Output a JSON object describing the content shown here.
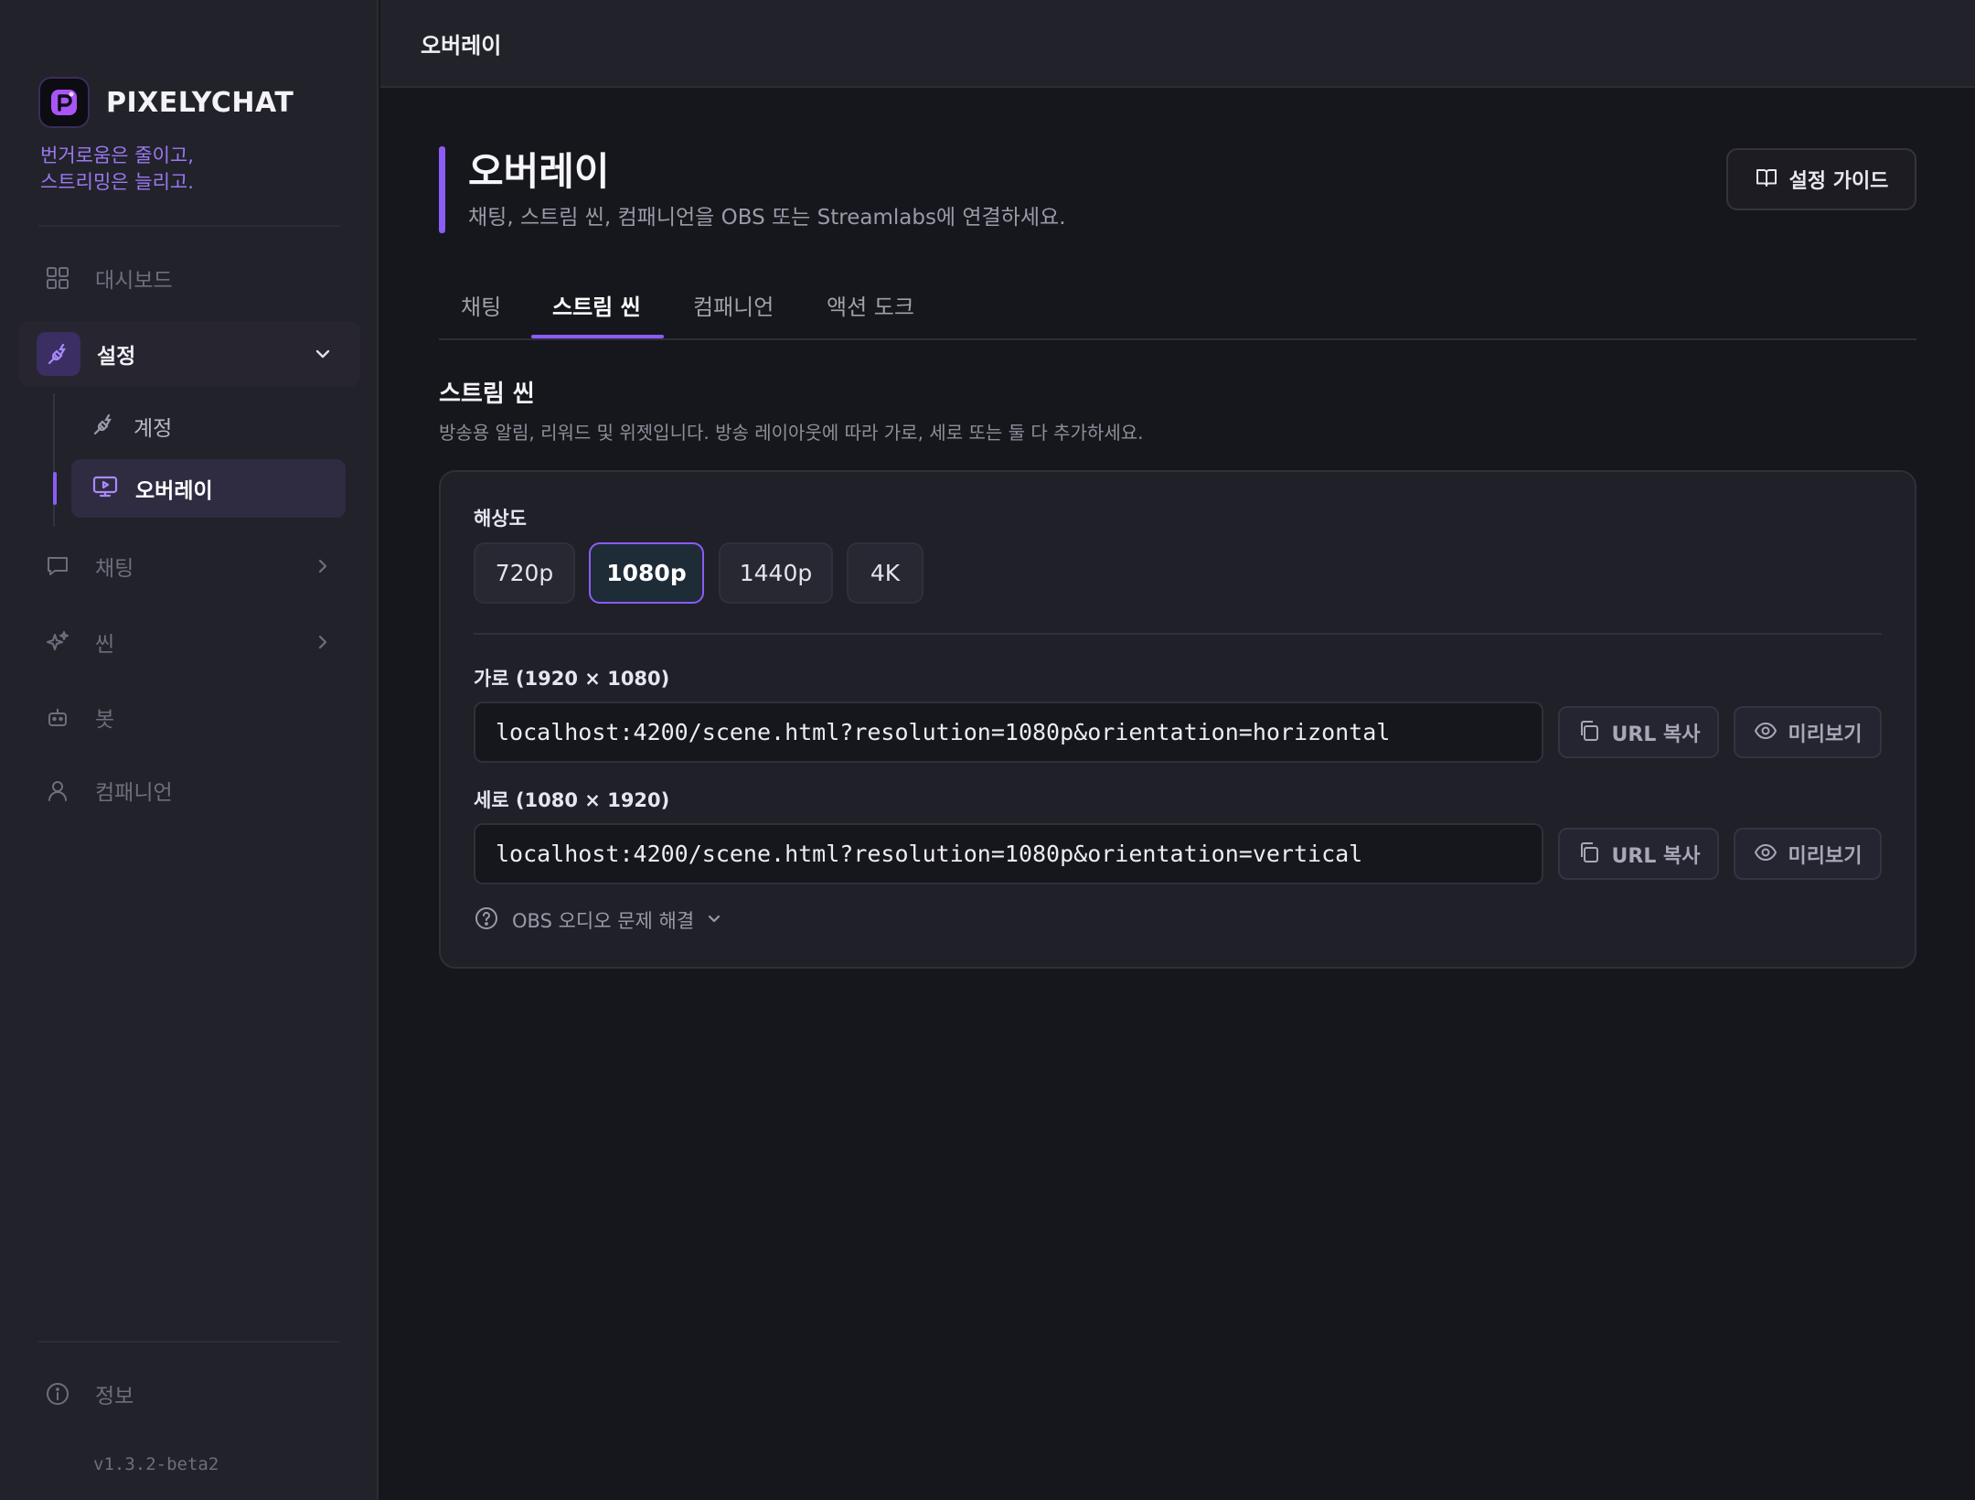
{
  "brand": {
    "name": "PIXELYCHAT",
    "tagline_line1": "번거로움은 줄이고,",
    "tagline_line2": "스트리밍은 늘리고."
  },
  "sidebar": {
    "dashboard": "대시보드",
    "settings": "설정",
    "settings_sub": {
      "account": "계정",
      "overlay": "오버레이"
    },
    "chat": "채팅",
    "scene": "씬",
    "bot": "봇",
    "companion": "컴패니언",
    "info": "정보",
    "version": "v1.3.2-beta2"
  },
  "header": {
    "title": "오버레이"
  },
  "page": {
    "title": "오버레이",
    "description": "채팅, 스트림 씬, 컴패니언을 OBS 또는 Streamlabs에 연결하세요.",
    "guide_button": "설정 가이드"
  },
  "tabs": [
    {
      "label": "채팅"
    },
    {
      "label": "스트림 씬",
      "active": true
    },
    {
      "label": "컴패니언"
    },
    {
      "label": "액션 도크"
    }
  ],
  "section": {
    "title": "스트림 씬",
    "description": "방송용 알림, 리워드 및 위젯입니다. 방송 레이아웃에 따라 가로, 세로 또는 둘 다 추가하세요.",
    "resolution_label": "해상도",
    "resolutions": [
      "720p",
      "1080p",
      "1440p",
      "4K"
    ],
    "selected_resolution": "1080p",
    "horizontal": {
      "label": "가로 (1920 × 1080)",
      "url": "localhost:4200/scene.html?resolution=1080p&orientation=horizontal"
    },
    "vertical": {
      "label": "세로 (1080 × 1920)",
      "url": "localhost:4200/scene.html?resolution=1080p&orientation=vertical"
    },
    "copy_url": "URL 복사",
    "preview": "미리보기",
    "obs_audio": "OBS 오디오 문제 해결"
  },
  "colors": {
    "accent": "#8b5cf6",
    "background": "#16171c",
    "sidebar": "#22222b"
  }
}
